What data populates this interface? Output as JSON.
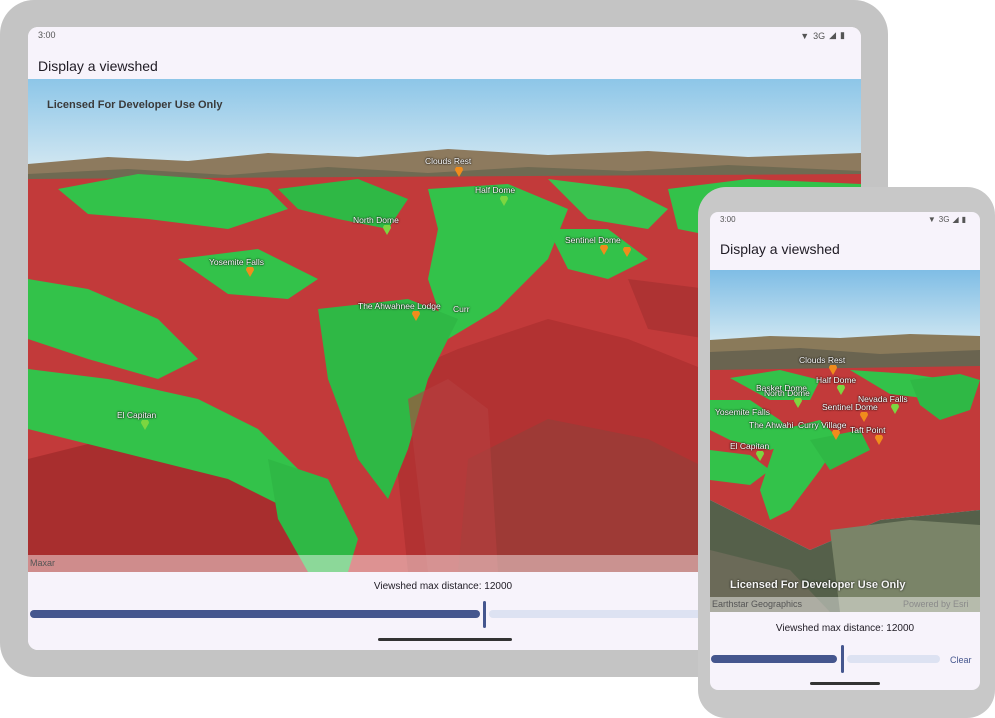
{
  "status": {
    "time": "3:00",
    "network": "3G"
  },
  "app": {
    "title": "Display a viewshed"
  },
  "map": {
    "watermark": "Licensed For Developer Use Only",
    "attribution_tablet": "Maxar",
    "attribution_phone": "Earthstar Geographics",
    "powered_by": "Powered by Esri"
  },
  "tablet_labels": {
    "clouds_rest": "Clouds Rest",
    "half_dome": "Half Dome",
    "north_dome": "North Dome",
    "sentinel_dome": "Sentinel Dome",
    "yosemite_falls": "Yosemite Falls",
    "ahwahnee": "The Ahwahnee Lodge",
    "curry": "Curr",
    "el_capitan": "El Capitan"
  },
  "phone_labels": {
    "clouds_rest": "Clouds Rest",
    "half_dome": "Half Dome",
    "basket_dome": "Basket Dome",
    "north_dome": "North Dome",
    "nevada_falls": "Nevada Falls",
    "sentinel_dome": "Sentinel Dome",
    "yosemite_falls": "Yosemite Falls",
    "ahwahnee": "The Ahwahi",
    "curry": "Curry Village",
    "taft_point": "Taft Point",
    "el_capitan": "El Capitan"
  },
  "viewshed": {
    "label": "Viewshed max distance: 12000",
    "value_fraction": 0.55,
    "clear_label": "Clear"
  },
  "colors": {
    "visible": "#33c24a",
    "not_visible": "#c23a3a",
    "accent": "#45568e"
  }
}
